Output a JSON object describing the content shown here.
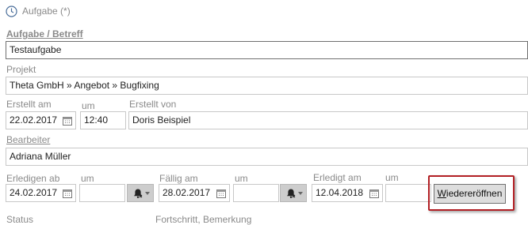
{
  "header": {
    "title": "Aufgabe (*)"
  },
  "subject": {
    "label": "Aufgabe / Betreff",
    "value": "Testaufgabe"
  },
  "project": {
    "label": "Projekt",
    "value": "Theta GmbH » Angebot » Bugfixing"
  },
  "created": {
    "date_label": "Erstellt am",
    "date_value": "22.02.2017",
    "time_label": "um",
    "time_value": "12:40",
    "by_label": "Erstellt von",
    "by_value": "Doris Beispiel"
  },
  "assignee": {
    "label": "Bearbeiter",
    "value": "Adriana Müller"
  },
  "schedule": {
    "start_label": "Erledigen ab",
    "start_date": "24.02.2017",
    "start_time_label": "um",
    "start_time": "",
    "due_label": "Fällig am",
    "due_date": "28.02.2017",
    "due_time_label": "um",
    "due_time": "",
    "done_label": "Erledigt am",
    "done_date": "12.04.2018",
    "done_time_label": "um",
    "done_time": ""
  },
  "actions": {
    "reopen_label": "Wiedereröffnen"
  },
  "footer_labels": {
    "status": "Status",
    "progress": "Fortschritt, Bemerkung"
  },
  "colors": {
    "highlight": "#b21f24",
    "button_bg": "#dddddd",
    "bell_bg": "#cdcdcd"
  }
}
